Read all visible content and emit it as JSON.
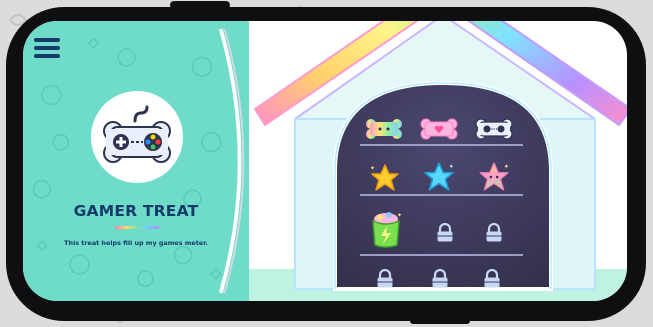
{
  "treat": {
    "title": "GAMER TREAT",
    "description": "This treat helps fill up my games meter.",
    "icon": "game-controller-icon"
  },
  "menu": {
    "icon": "hamburger-menu-icon"
  },
  "colors": {
    "panel_bg": "#6fdcc9",
    "title_color": "#163a6a",
    "shelf_bg": "#3d3a58",
    "house_wall": "#e6f7f8",
    "frame": "#0f0f11"
  },
  "shelves": [
    {
      "row": "top",
      "items": [
        {
          "name": "rainbow-bone-icon",
          "locked": false
        },
        {
          "name": "pink-heart-bone-icon",
          "locked": false
        },
        {
          "name": "controller-bone-icon",
          "locked": false
        }
      ]
    },
    {
      "row": "second",
      "items": [
        {
          "name": "gold-star-icon",
          "locked": false
        },
        {
          "name": "blue-star-icon",
          "locked": false
        },
        {
          "name": "rainbow-star-icon",
          "locked": false
        }
      ]
    },
    {
      "row": "third",
      "items": [
        {
          "name": "green-treat-bag-icon",
          "locked": false
        },
        {
          "name": "padlock-icon",
          "locked": true
        },
        {
          "name": "padlock-icon",
          "locked": true
        }
      ]
    },
    {
      "row": "bottom",
      "items": [
        {
          "name": "padlock-icon",
          "locked": true
        },
        {
          "name": "padlock-icon",
          "locked": true
        },
        {
          "name": "padlock-icon",
          "locked": true
        }
      ]
    }
  ]
}
